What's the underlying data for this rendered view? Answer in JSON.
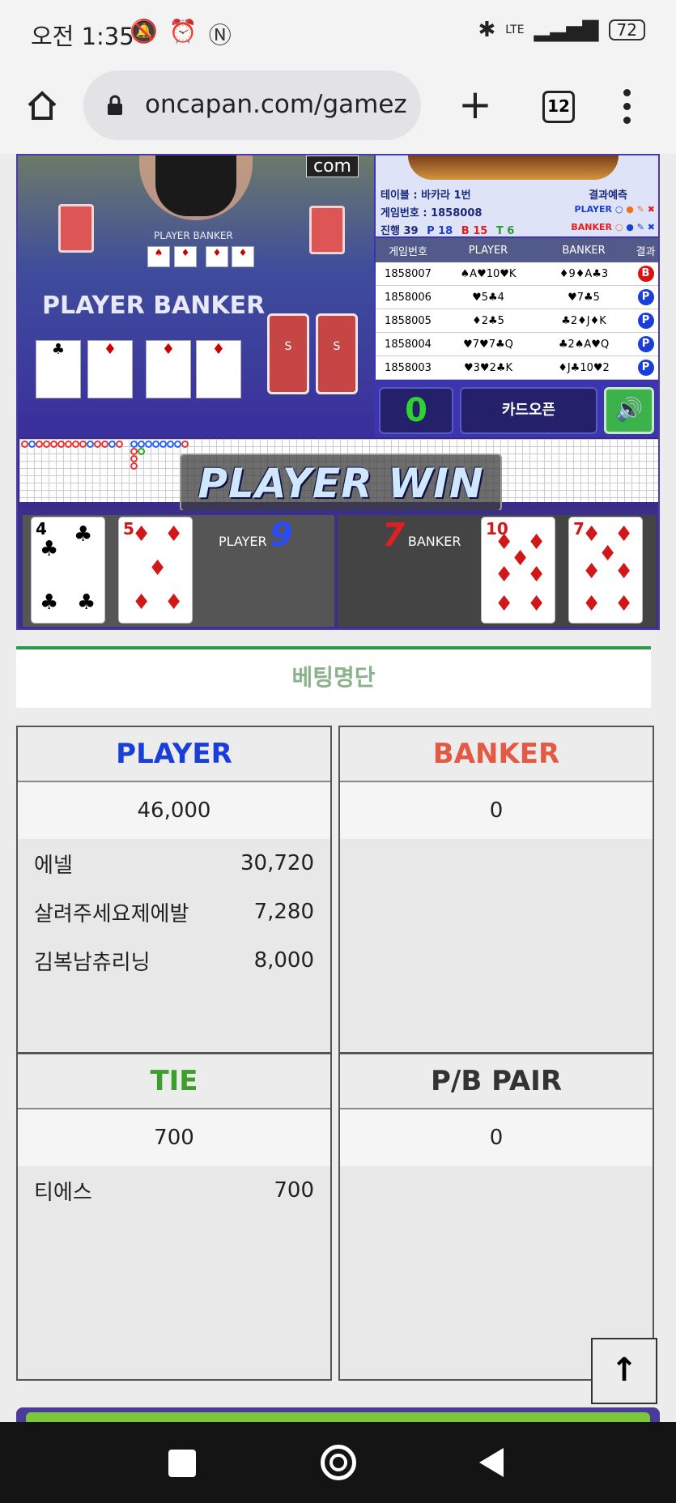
{
  "status": {
    "time": "오전 1:35",
    "network": "LTE",
    "battery": "72"
  },
  "browser": {
    "url": "oncapan.com/gamez",
    "tab_count": "12"
  },
  "game": {
    "com_label": "com",
    "table_label": "PLAYER BANKER",
    "video_title": "PLAYER BANKER",
    "info": {
      "table": "테이블 : 바카라 1번",
      "prediction_label": "결과예측",
      "game_no": "게임번호 : 1858008",
      "progress": "진행 39",
      "p_count": "P 18",
      "b_count": "B 15",
      "t_count": "T 6",
      "player_label": "PLAYER",
      "banker_label": "BANKER"
    },
    "history_headers": [
      "게임번호",
      "PLAYER",
      "BANKER",
      "결과"
    ],
    "history": [
      {
        "no": "1858007",
        "player": "♠A♥10♥K",
        "banker": "♦9♦A♣3",
        "result": "B"
      },
      {
        "no": "1858006",
        "player": "♥5♣4",
        "banker": "♥7♣5",
        "result": "P"
      },
      {
        "no": "1858005",
        "player": "♦2♣5",
        "banker": "♣2♦J♦K",
        "result": "P"
      },
      {
        "no": "1858004",
        "player": "♥7♥7♣Q",
        "banker": "♣2♠A♥Q",
        "result": "P"
      },
      {
        "no": "1858003",
        "player": "♥3♥2♣K",
        "banker": "♦J♣10♥2",
        "result": "P"
      }
    ],
    "counter": "0",
    "card_open": "카드오픈",
    "win_text": "PLAYER WIN",
    "player_label": "PLAYER",
    "player_score": "9",
    "banker_label": "BANKER",
    "banker_score": "7",
    "player_cards": [
      {
        "rank": "4",
        "suit": "♣",
        "color": "#000000"
      },
      {
        "rank": "5",
        "suit": "♦",
        "color": "#d01818"
      }
    ],
    "banker_cards": [
      {
        "rank": "10",
        "suit": "♦",
        "color": "#d01818"
      },
      {
        "rank": "7",
        "suit": "♦",
        "color": "#d01818"
      }
    ]
  },
  "betting": {
    "title": "베팅명단",
    "boxes": [
      {
        "name": "PLAYER",
        "color": "#1a3fd8",
        "total": "46,000",
        "rows": [
          {
            "user": "에넬",
            "amount": "30,720"
          },
          {
            "user": "살려주세요제에발",
            "amount": "7,280"
          },
          {
            "user": "김복남츄리닝",
            "amount": "8,000"
          }
        ]
      },
      {
        "name": "BANKER",
        "color": "#e25a44",
        "total": "0",
        "rows": []
      },
      {
        "name": "TIE",
        "color": "#3aa02a",
        "total": "700",
        "rows": [
          {
            "user": "티에스",
            "amount": "700"
          }
        ]
      },
      {
        "name": "P/B PAIR",
        "color": "#333333",
        "total": "0",
        "rows": []
      }
    ]
  }
}
